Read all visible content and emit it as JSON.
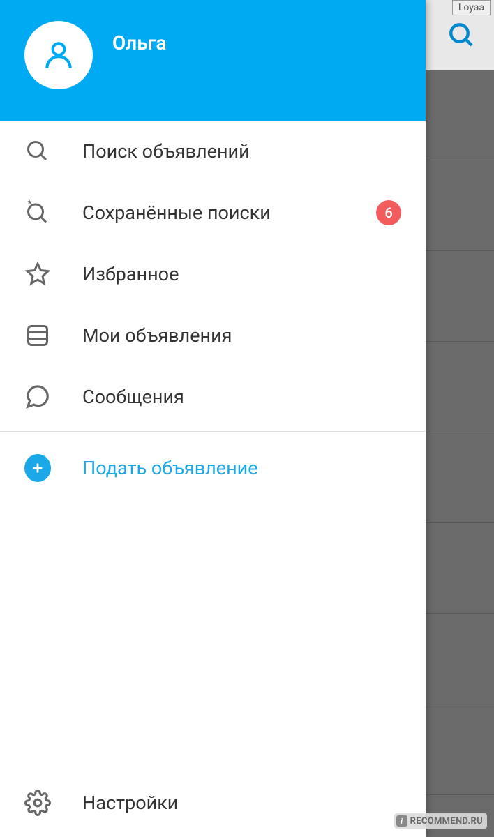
{
  "profile": {
    "name": "Ольга"
  },
  "menu": {
    "search_ads": "Поиск объявлений",
    "saved_searches": "Сохранённые поиски",
    "saved_searches_count": "6",
    "favorites": "Избранное",
    "my_ads": "Мои объявления",
    "messages": "Сообщения",
    "post_ad": "Подать объявление",
    "settings": "Настройки"
  },
  "background": {
    "tag_label": "Loyaa"
  },
  "watermark": {
    "text": "RECOMMEND.RU"
  }
}
